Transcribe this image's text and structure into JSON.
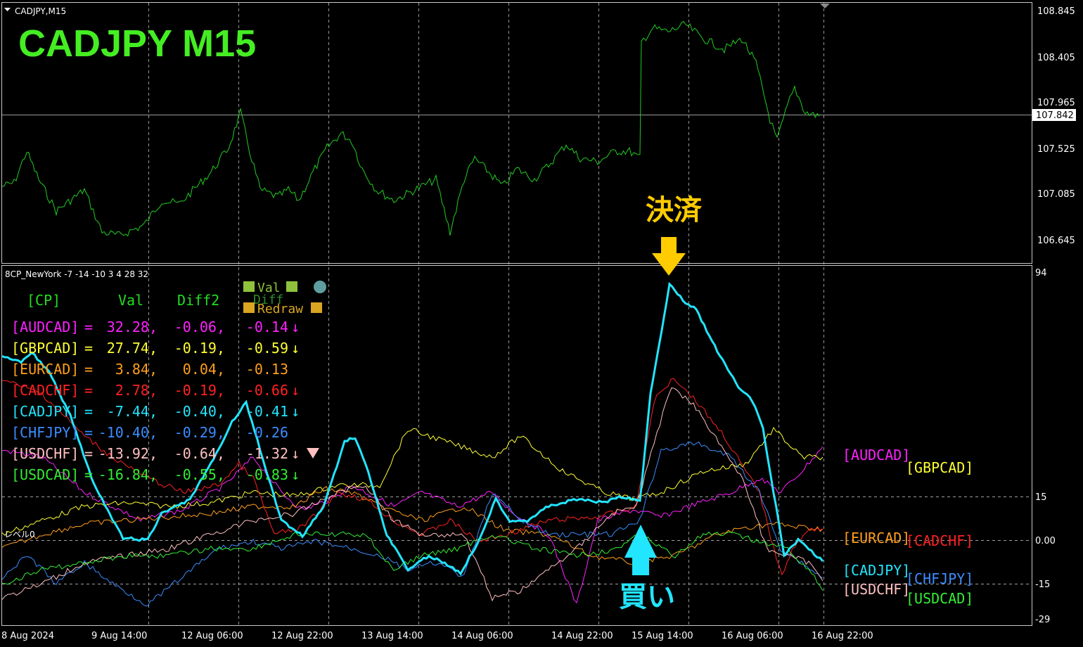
{
  "window": {
    "title": "CADJPY,M15",
    "big_title": "CADJPY  M15",
    "current_price": "107.842"
  },
  "price_axis": {
    "labels": [
      "108.845",
      "108.405",
      "107.965",
      "107.525",
      "107.085",
      "106.645"
    ]
  },
  "indicator": {
    "name": "8CP_NewYork -7 -14 -10 3 4 28 32",
    "level_label": "レベル0",
    "axis_labels": [
      "94",
      "15",
      "0.00",
      "-15",
      "-29"
    ],
    "buttons": {
      "val": "Val",
      "diff": "Diff",
      "redraw": "Redraw"
    },
    "table_headers": [
      "[CP]",
      "Val",
      "Diff2",
      "Diff"
    ],
    "table_rows": [
      {
        "pair": "[AUDCAD]",
        "eq": "=",
        "val": "32.28,",
        "diff2": "-0.06,",
        "diff": "-0.14",
        "arrow": "↓",
        "color": "#ff22ff"
      },
      {
        "pair": "[GBPCAD]",
        "eq": "=",
        "val": "27.74,",
        "diff2": "-0.19,",
        "diff": "-0.59",
        "arrow": "↓",
        "color": "#ffff33"
      },
      {
        "pair": "[EURCAD]",
        "eq": "=",
        "val": "3.84,",
        "diff2": "0.04,",
        "diff": "-0.13",
        "arrow": "",
        "color": "#ff9f1a"
      },
      {
        "pair": "[CADCHF]",
        "eq": "=",
        "val": "2.78,",
        "diff2": "-0.19,",
        "diff": "-0.66",
        "arrow": "↓",
        "color": "#ff2222"
      },
      {
        "pair": "[CADJPY]",
        "eq": "=",
        "val": "-7.44,",
        "diff2": "-0.40,",
        "diff": "-0.41",
        "arrow": "↓",
        "color": "#22e5ff"
      },
      {
        "pair": "[CHFJPY]",
        "eq": "=",
        "val": "-10.40,",
        "diff2": "-0.29,",
        "diff": "-0.26",
        "arrow": "",
        "color": "#3a8dff"
      },
      {
        "pair": "[USDCHF]",
        "eq": "=",
        "val": "-13.92,",
        "diff2": "-0.64,",
        "diff": "-1.32",
        "arrow": "↓",
        "color": "#ffc0c0"
      },
      {
        "pair": "[USDCAD]",
        "eq": "=",
        "val": "-16.84,",
        "diff2": "-0.55,",
        "diff": "-0.83",
        "arrow": "↓",
        "color": "#33ee33"
      }
    ],
    "right_labels": [
      {
        "text": "[AUDCAD]",
        "color": "#ff22ff"
      },
      {
        "text": "[GBPCAD]",
        "color": "#ffff33"
      },
      {
        "text": "[EURCAD]",
        "color": "#ff9f1a"
      },
      {
        "text": "[CADCHF]",
        "color": "#ff2222"
      },
      {
        "text": "[CADJPY]",
        "color": "#22e5ff"
      },
      {
        "text": "[CHFJPY]",
        "color": "#3a8dff"
      },
      {
        "text": "[USDCHF]",
        "color": "#ffc0c0"
      },
      {
        "text": "[USDCAD]",
        "color": "#33ee33"
      }
    ]
  },
  "annotations": {
    "settle": "決済",
    "buy": "買い"
  },
  "time_axis": {
    "labels": [
      "8 Aug 2024",
      "9 Aug 14:00",
      "12 Aug 06:00",
      "12 Aug 22:00",
      "13 Aug 14:00",
      "14 Aug 06:00",
      "14 Aug 22:00",
      "15 Aug 14:00",
      "16 Aug 06:00",
      "16 Aug 22:00"
    ]
  },
  "colors": {
    "price_line": "#22cc22",
    "big_title": "#44ee22",
    "settle": "#ffcc00",
    "buy": "#22e5ff",
    "grid": "#c8c8c8"
  }
}
